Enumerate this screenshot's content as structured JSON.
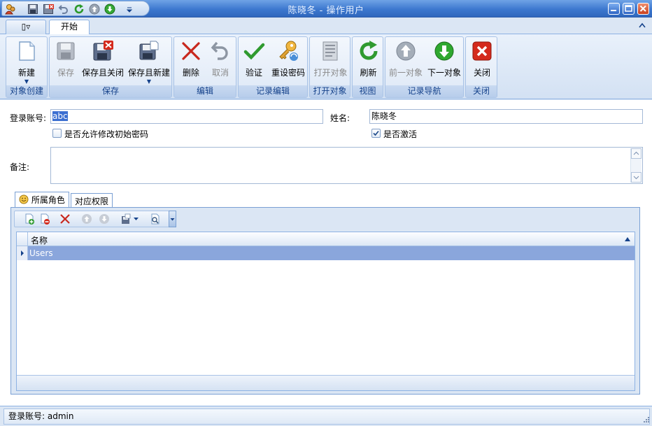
{
  "window": {
    "title": "陈晓冬 - 操作用户",
    "accent": "#3d78cf"
  },
  "quick_access": {
    "icons": [
      "app-icon",
      "save-icon",
      "save-close-icon",
      "undo-icon",
      "refresh-icon",
      "prev-icon",
      "next-icon",
      "customize-icon"
    ]
  },
  "tabs": {
    "view_menu": "▯▿",
    "home": "开始"
  },
  "ribbon": {
    "groups": {
      "create": "对象创建",
      "save": "保存",
      "edit": "编辑",
      "record_edit": "记录编辑",
      "open": "打开对象",
      "view": "视图",
      "nav": "记录导航",
      "close": "关闭"
    },
    "buttons": {
      "new": "新建",
      "save": "保存",
      "save_close": "保存且关闭",
      "save_new": "保存且新建",
      "delete": "删除",
      "cancel": "取消",
      "validate": "验证",
      "reset_password": "重设密码",
      "open_object": "打开对象",
      "refresh": "刷新",
      "prev": "前一对象",
      "next": "下一对象",
      "close": "关闭"
    }
  },
  "form": {
    "login_label": "登录账号:",
    "login_value": "abc",
    "name_label": "姓名:",
    "name_value": "陈晓冬",
    "allow_change_label": "是否允许修改初始密码",
    "allow_change_checked": false,
    "active_label": "是否激活",
    "active_checked": true,
    "note_label": "备注:",
    "note_value": ""
  },
  "inner_tabs": {
    "roles": "所属角色",
    "permissions": "对应权限"
  },
  "grid": {
    "columns": [
      "名称"
    ],
    "rows": [
      [
        "Users"
      ]
    ],
    "selected_color": "#8aa6dc"
  },
  "status": {
    "text": "登录账号: admin"
  }
}
